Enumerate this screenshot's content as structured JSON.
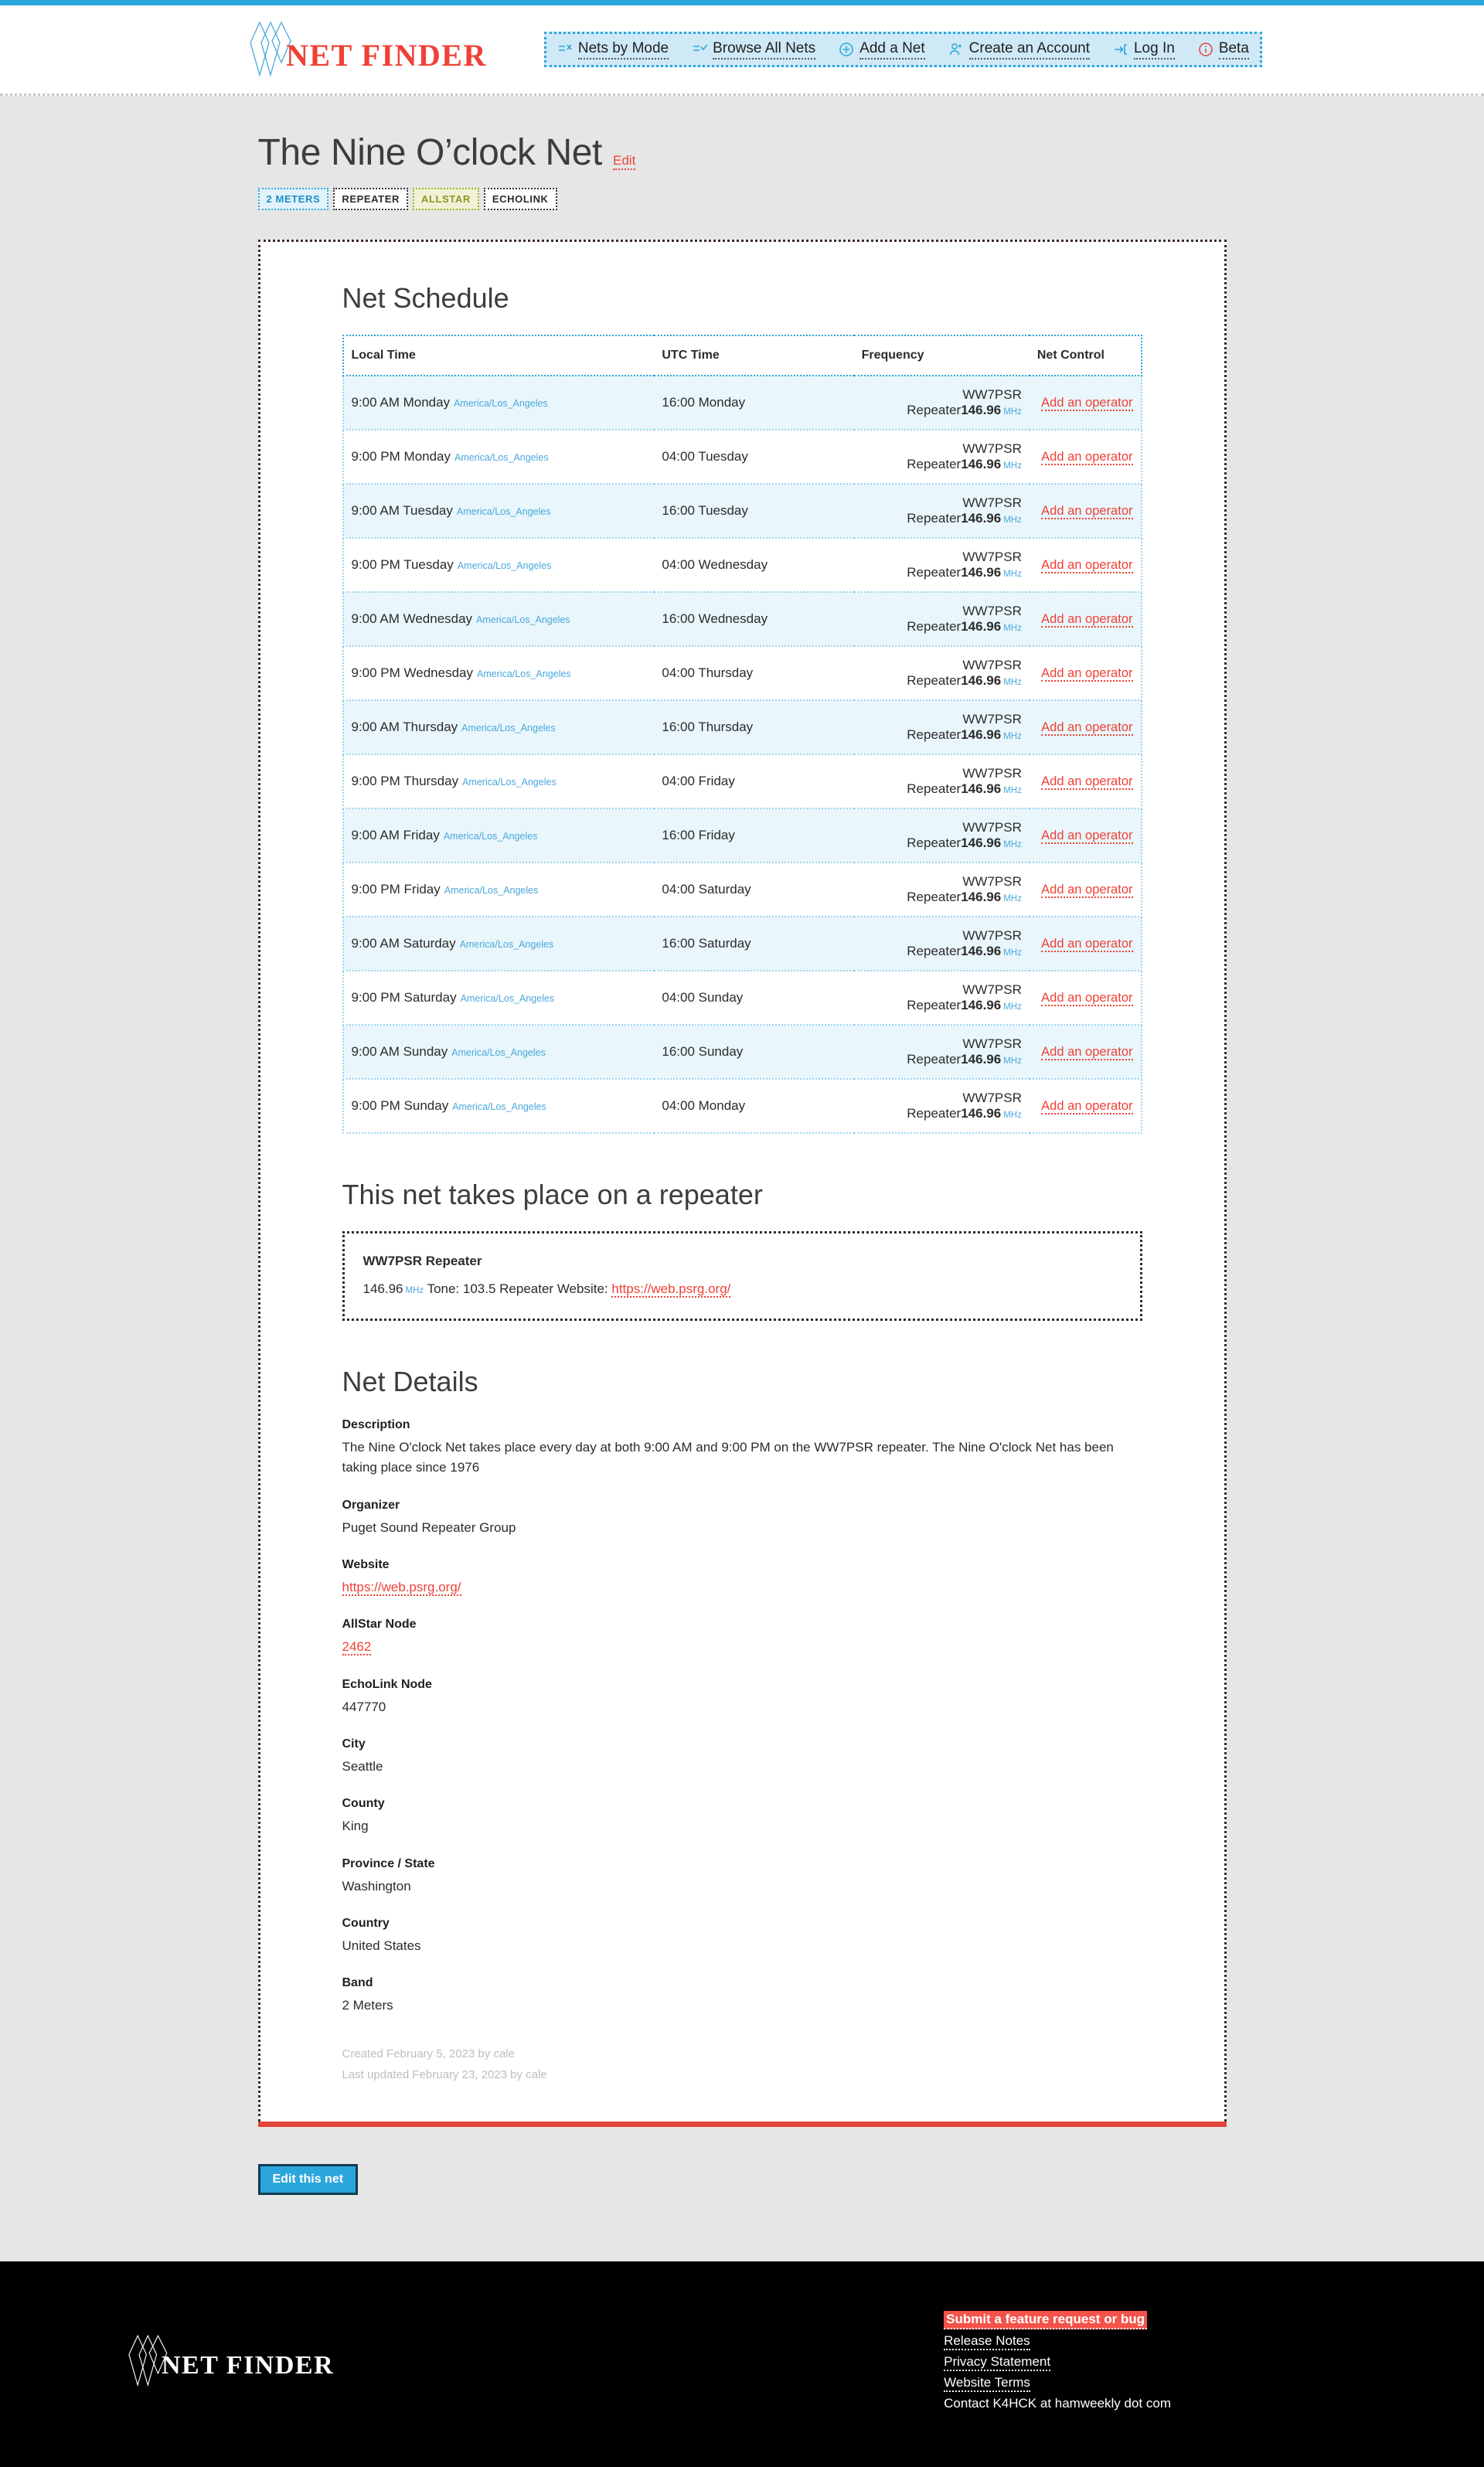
{
  "brand": {
    "name": "NET FINDER",
    "logo_icon": "netfinder-diamonds-logo"
  },
  "nav": {
    "items": [
      {
        "label": "Nets by Mode",
        "icon": "filter-list-x-icon"
      },
      {
        "label": "Browse All Nets",
        "icon": "checklist-icon"
      },
      {
        "label": "Add a Net",
        "icon": "plus-circle-icon"
      },
      {
        "label": "Create an Account",
        "icon": "user-plus-icon"
      },
      {
        "label": "Log In",
        "icon": "login-arrow-icon"
      },
      {
        "label": "Beta",
        "icon": "info-circle-icon"
      }
    ]
  },
  "page": {
    "title": "The Nine O’clock Net",
    "edit_label": "Edit",
    "tags": [
      {
        "label": "2 METERS",
        "style": "blue"
      },
      {
        "label": "REPEATER",
        "style": "plain"
      },
      {
        "label": "ALLSTAR",
        "style": "olive"
      },
      {
        "label": "ECHOLINK",
        "style": "plain"
      }
    ]
  },
  "schedule": {
    "heading": "Net Schedule",
    "columns": [
      "Local Time",
      "UTC Time",
      "Frequency",
      "Net Control"
    ],
    "timezone": "America/Los_Angeles",
    "frequency_unit": "MHz",
    "net_control_label": "Add an operator",
    "rows": [
      {
        "local": "9:00 AM Monday",
        "tz": "America/Los_Angeles",
        "utc": "16:00 Monday",
        "repeater": "WW7PSR Repeater",
        "freq": "146.96",
        "unit": "MHz",
        "control": "Add an operator"
      },
      {
        "local": "9:00 PM Monday",
        "tz": "America/Los_Angeles",
        "utc": "04:00 Tuesday",
        "repeater": "WW7PSR Repeater",
        "freq": "146.96",
        "unit": "MHz",
        "control": "Add an operator"
      },
      {
        "local": "9:00 AM Tuesday",
        "tz": "America/Los_Angeles",
        "utc": "16:00 Tuesday",
        "repeater": "WW7PSR Repeater",
        "freq": "146.96",
        "unit": "MHz",
        "control": "Add an operator"
      },
      {
        "local": "9:00 PM Tuesday",
        "tz": "America/Los_Angeles",
        "utc": "04:00 Wednesday",
        "repeater": "WW7PSR Repeater",
        "freq": "146.96",
        "unit": "MHz",
        "control": "Add an operator"
      },
      {
        "local": "9:00 AM Wednesday",
        "tz": "America/Los_Angeles",
        "utc": "16:00 Wednesday",
        "repeater": "WW7PSR Repeater",
        "freq": "146.96",
        "unit": "MHz",
        "control": "Add an operator"
      },
      {
        "local": "9:00 PM Wednesday",
        "tz": "America/Los_Angeles",
        "utc": "04:00 Thursday",
        "repeater": "WW7PSR Repeater",
        "freq": "146.96",
        "unit": "MHz",
        "control": "Add an operator"
      },
      {
        "local": "9:00 AM Thursday",
        "tz": "America/Los_Angeles",
        "utc": "16:00 Thursday",
        "repeater": "WW7PSR Repeater",
        "freq": "146.96",
        "unit": "MHz",
        "control": "Add an operator"
      },
      {
        "local": "9:00 PM Thursday",
        "tz": "America/Los_Angeles",
        "utc": "04:00 Friday",
        "repeater": "WW7PSR Repeater",
        "freq": "146.96",
        "unit": "MHz",
        "control": "Add an operator"
      },
      {
        "local": "9:00 AM Friday",
        "tz": "America/Los_Angeles",
        "utc": "16:00 Friday",
        "repeater": "WW7PSR Repeater",
        "freq": "146.96",
        "unit": "MHz",
        "control": "Add an operator"
      },
      {
        "local": "9:00 PM Friday",
        "tz": "America/Los_Angeles",
        "utc": "04:00 Saturday",
        "repeater": "WW7PSR Repeater",
        "freq": "146.96",
        "unit": "MHz",
        "control": "Add an operator"
      },
      {
        "local": "9:00 AM Saturday",
        "tz": "America/Los_Angeles",
        "utc": "16:00 Saturday",
        "repeater": "WW7PSR Repeater",
        "freq": "146.96",
        "unit": "MHz",
        "control": "Add an operator"
      },
      {
        "local": "9:00 PM Saturday",
        "tz": "America/Los_Angeles",
        "utc": "04:00 Sunday",
        "repeater": "WW7PSR Repeater",
        "freq": "146.96",
        "unit": "MHz",
        "control": "Add an operator"
      },
      {
        "local": "9:00 AM Sunday",
        "tz": "America/Los_Angeles",
        "utc": "16:00 Sunday",
        "repeater": "WW7PSR Repeater",
        "freq": "146.96",
        "unit": "MHz",
        "control": "Add an operator"
      },
      {
        "local": "9:00 PM Sunday",
        "tz": "America/Los_Angeles",
        "utc": "04:00 Monday",
        "repeater": "WW7PSR Repeater",
        "freq": "146.96",
        "unit": "MHz",
        "control": "Add an operator"
      }
    ]
  },
  "repeater": {
    "heading": "This net takes place on a repeater",
    "name": "WW7PSR Repeater",
    "frequency": "146.96",
    "unit": "MHz",
    "tone_label": "Tone: 103.5",
    "website_label": "Repeater Website:",
    "website_url": "https://web.psrg.org/"
  },
  "details": {
    "heading": "Net Details",
    "fields": [
      {
        "label": "Description",
        "value": "The Nine O'clock Net takes place every day at both 9:00 AM and 9:00 PM on the WW7PSR repeater. The Nine O'clock Net has been taking place since 1976",
        "link": false
      },
      {
        "label": "Organizer",
        "value": "Puget Sound Repeater Group",
        "link": false
      },
      {
        "label": "Website",
        "value": "https://web.psrg.org/",
        "link": true
      },
      {
        "label": "AllStar Node",
        "value": "2462",
        "link": true
      },
      {
        "label": "EchoLink Node",
        "value": "447770",
        "link": false
      },
      {
        "label": "City",
        "value": "Seattle",
        "link": false
      },
      {
        "label": "County",
        "value": "King",
        "link": false
      },
      {
        "label": "Province / State",
        "value": "Washington",
        "link": false
      },
      {
        "label": "Country",
        "value": "United States",
        "link": false
      },
      {
        "label": "Band",
        "value": "2 Meters",
        "link": false
      }
    ],
    "created": "Created February 5, 2023 by cale",
    "last_updated": "Last updated February 23, 2023 by cale"
  },
  "actions": {
    "edit_net_label": "Edit this net"
  },
  "footer": {
    "brand": "NET FINDER",
    "links": [
      {
        "label": "Submit a feature request or bug",
        "highlight": true
      },
      {
        "label": "Release Notes",
        "highlight": false
      },
      {
        "label": "Privacy Statement",
        "highlight": false
      },
      {
        "label": "Website Terms",
        "highlight": false
      }
    ],
    "contact": "Contact K4HCK at hamweekly dot com"
  },
  "colors": {
    "accent_blue": "#2ba6dd",
    "accent_red": "#ef4136",
    "olive": "#a2ad26",
    "page_bg": "#e6e6e6",
    "footer_bg": "#000000"
  }
}
